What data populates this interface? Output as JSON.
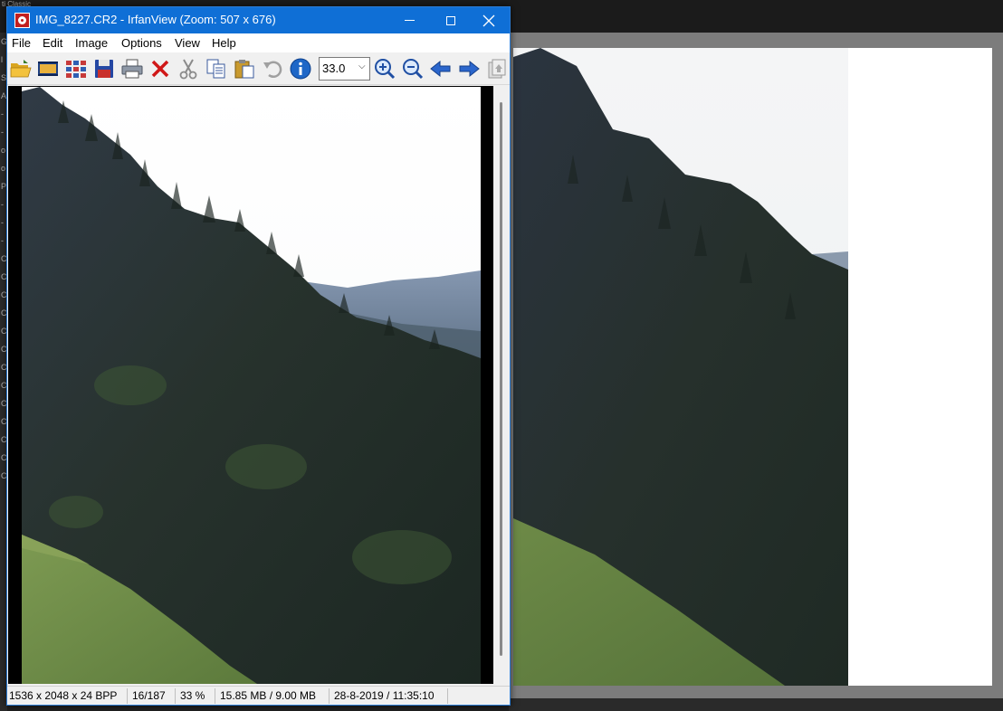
{
  "background_app": {
    "title_fragment": "ti Classic",
    "left_labels": [
      "G",
      "l",
      "S",
      "A",
      "-",
      "-",
      "o",
      "o",
      "P",
      "-",
      "-",
      "-",
      "C",
      "C",
      "C",
      "C",
      "C",
      "C",
      "C",
      "C",
      "C",
      "C",
      "C",
      "C",
      "C"
    ]
  },
  "window": {
    "title": "IMG_8227.CR2 - IrfanView (Zoom: 507 x 676)",
    "accent_color": "#0f6fd6"
  },
  "menu": {
    "items": [
      "File",
      "Edit",
      "Image",
      "Options",
      "View",
      "Help"
    ]
  },
  "toolbar": {
    "icons": [
      "open-folder-icon",
      "slideshow-icon",
      "thumbnails-icon",
      "save-icon",
      "print-icon",
      "delete-icon",
      "cut-icon",
      "copy-icon",
      "paste-icon",
      "undo-icon",
      "info-icon"
    ],
    "zoom_value": "33.0",
    "nav_icons": [
      "zoom-in-icon",
      "zoom-out-icon",
      "previous-icon",
      "next-icon",
      "page-icon"
    ]
  },
  "status": {
    "dimensions": "1536 x 2048 x 24 BPP",
    "index": "16/187",
    "zoom": "33 %",
    "memory": "15.85 MB / 9.00 MB",
    "datetime": "28-8-2019 / 11:35:10"
  }
}
